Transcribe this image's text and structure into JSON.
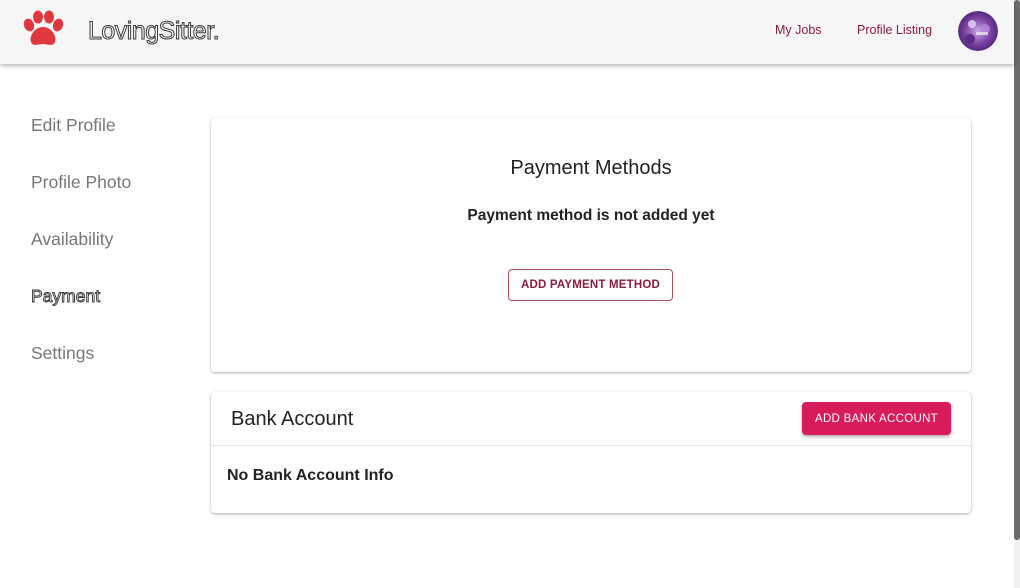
{
  "header": {
    "brand": "LovingSitter.",
    "nav": [
      {
        "label": "My Jobs"
      },
      {
        "label": "Profile Listing"
      }
    ]
  },
  "sidebar": {
    "items": [
      {
        "label": "Edit Profile"
      },
      {
        "label": "Profile Photo"
      },
      {
        "label": "Availability"
      },
      {
        "label": "Payment"
      },
      {
        "label": "Settings"
      }
    ],
    "active_index": 3
  },
  "payment_methods": {
    "title": "Payment Methods",
    "empty_text": "Payment method is not added yet",
    "add_button": "ADD PAYMENT METHOD"
  },
  "bank_account": {
    "title": "Bank Account",
    "add_button": "ADD BANK ACCOUNT",
    "empty_text": "No Bank Account Info"
  },
  "colors": {
    "brand_red": "#e0383e",
    "accent_maroon": "#8b1d3d",
    "primary_pink": "#d81b5a"
  },
  "icons": {
    "logo": "paw-icon",
    "avatar": "user-avatar"
  }
}
